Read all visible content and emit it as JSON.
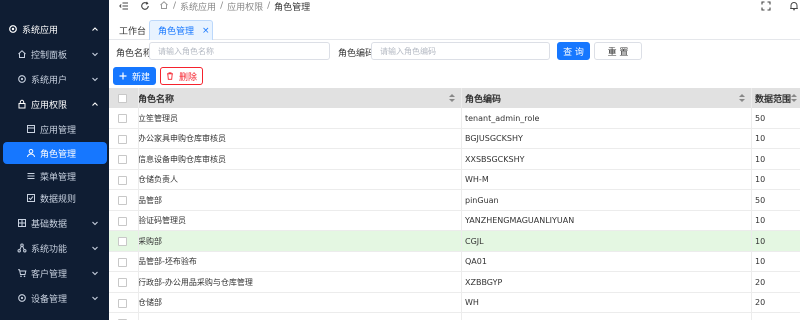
{
  "sidebar": {
    "items": [
      {
        "label": "系统应用",
        "icon": "gear-icon",
        "level": 0,
        "chevron": "up",
        "title": true
      },
      {
        "label": "控制面板",
        "icon": "home-icon",
        "level": 1,
        "chevron": "down"
      },
      {
        "label": "系统用户",
        "icon": "gear-icon",
        "level": 1,
        "chevron": "down"
      },
      {
        "label": "应用权限",
        "icon": "lock-icon",
        "level": 1,
        "chevron": "up",
        "title": true
      },
      {
        "label": "应用管理",
        "icon": "app-icon",
        "level": 2
      },
      {
        "label": "角色管理",
        "icon": "user-icon",
        "level": 2,
        "active": true
      },
      {
        "label": "菜单管理",
        "icon": "menu-icon",
        "level": 2
      },
      {
        "label": "数据规则",
        "icon": "check-square-icon",
        "level": 2
      },
      {
        "label": "基础数据",
        "icon": "grid-icon",
        "level": 1,
        "chevron": "down"
      },
      {
        "label": "系统功能",
        "icon": "share-icon",
        "level": 1,
        "chevron": "down"
      },
      {
        "label": "客户管理",
        "icon": "cart-icon",
        "level": 1,
        "chevron": "down"
      },
      {
        "label": "设备管理",
        "icon": "gear-icon",
        "level": 1,
        "chevron": "down"
      }
    ]
  },
  "breadcrumb": {
    "items": [
      "系统应用",
      "应用权限",
      "角色管理"
    ],
    "separator": "/"
  },
  "tabs": [
    {
      "label": "工作台",
      "active": false
    },
    {
      "label": "角色管理",
      "active": true,
      "closable": true,
      "close_glyph": "×"
    }
  ],
  "search": {
    "name_label": "角色名称",
    "name_placeholder": "请输入角色名称",
    "code_label": "角色编码",
    "code_placeholder": "请输入角色编码",
    "query_label": "查 询",
    "reset_label": "重 置"
  },
  "toolbar": {
    "add_label": "新建",
    "delete_label": "删除"
  },
  "table": {
    "columns": [
      "角色名称",
      "角色编码",
      "数据范围"
    ],
    "rows": [
      {
        "name": "立笙管理员",
        "code": "tenant_admin_role",
        "scope": "50"
      },
      {
        "name": "办公家具申购仓库审核员",
        "code": "BGJUSGCKSHY",
        "scope": "10"
      },
      {
        "name": "信息设备申购仓库审核员",
        "code": "XXSBSGCKSHY",
        "scope": "10"
      },
      {
        "name": "仓储负责人",
        "code": "WH-M",
        "scope": "10"
      },
      {
        "name": "品管部",
        "code": "pinGuan",
        "scope": "50"
      },
      {
        "name": "验证码管理员",
        "code": "YANZHENGMAGUANLIYUAN",
        "scope": "10"
      },
      {
        "name": "采购部",
        "code": "CGJL",
        "scope": "10",
        "highlighted": true
      },
      {
        "name": "品管部-坯布验布",
        "code": "QA01",
        "scope": "10"
      },
      {
        "name": "行政部-办公用品采购与仓库管理",
        "code": "XZBBGYP",
        "scope": "20"
      },
      {
        "name": "仓储部",
        "code": "WH",
        "scope": "20"
      },
      {
        "name": "",
        "code": "",
        "scope": ""
      }
    ]
  },
  "colors": {
    "sidebar_bg": "#0f1d33",
    "accent": "#1677ff",
    "danger": "#f5222d",
    "row_highlight": "#e4f7e2",
    "header_bg": "#e1e1e1"
  }
}
